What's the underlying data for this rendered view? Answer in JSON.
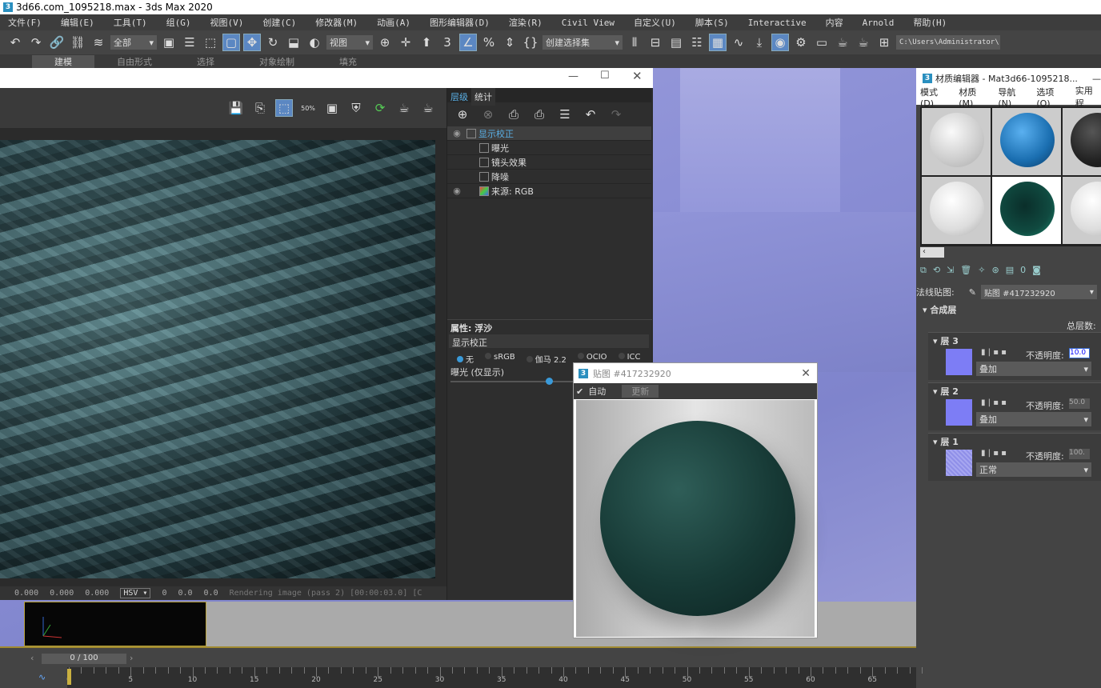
{
  "window": {
    "title": "3d66.com_1095218.max - 3ds Max 2020"
  },
  "menu": [
    "文件(F)",
    "编辑(E)",
    "工具(T)",
    "组(G)",
    "视图(V)",
    "创建(C)",
    "修改器(M)",
    "动画(A)",
    "图形编辑器(D)",
    "渲染(R)",
    "Civil View",
    "自定义(U)",
    "脚本(S)",
    "Interactive",
    "内容",
    "Arnold",
    "帮助(H)"
  ],
  "toolbar": {
    "selection_filter": "全部",
    "ref_coord": "视图",
    "named_set": "创建选择集",
    "path": "C:\\Users\\Administrator\\"
  },
  "ribbon": {
    "tabs": [
      "建模",
      "自由形式",
      "选择",
      "对象绘制",
      "填充"
    ]
  },
  "render_window": {
    "layer_tabs": [
      "层级",
      "统计"
    ],
    "layers": [
      {
        "label": "显示校正",
        "eye": true,
        "selected": true
      },
      {
        "label": "曝光",
        "eye": false
      },
      {
        "label": "镜头效果",
        "eye": false
      },
      {
        "label": "降噪",
        "eye": false
      },
      {
        "label": "来源: RGB",
        "eye": true
      }
    ],
    "props_title": "属性: 浮沙",
    "props_name": "显示校正",
    "radio_options": [
      "无",
      "sRGB",
      "伽马 2.2",
      "OCIO",
      "ICC"
    ],
    "radio_selected": "无",
    "exposure_label": "曝光 (仅显示)",
    "exposure_slider": 0.5,
    "status": {
      "r": "0.000",
      "g": "0.000",
      "b": "0.000",
      "mode": "HSV",
      "h": "0",
      "s": "0.0",
      "v": "0.0",
      "message": "Rendering image (pass 2) [00:00:03.0] [C"
    }
  },
  "timeline": {
    "frame": "0 / 100",
    "ticks": [
      0,
      5,
      10,
      15,
      20,
      25,
      30,
      35,
      40,
      45,
      50,
      55,
      60,
      65
    ]
  },
  "material_editor": {
    "title": "材质编辑器 - Mat3d66-1095218...",
    "menu": [
      "模式(D)",
      "材质(M)",
      "导航(N)",
      "选项(O)",
      "实用程"
    ],
    "map_label": "法线贴图:",
    "map_value": "贴图 #417232920",
    "rollout": "合成层",
    "total_layers_label": "总层数:",
    "opacity_label": "不透明度:",
    "layers": [
      {
        "name": "层 3",
        "opacity": "10.0",
        "blend": "叠加",
        "selected": true
      },
      {
        "name": "层 2",
        "opacity": "50.0",
        "blend": "叠加"
      },
      {
        "name": "层 1",
        "opacity": "100.",
        "blend": "正常"
      }
    ]
  },
  "map_window": {
    "title": "贴图 #417232920",
    "auto_label": "自动",
    "auto_checked": true,
    "update_label": "更新"
  }
}
